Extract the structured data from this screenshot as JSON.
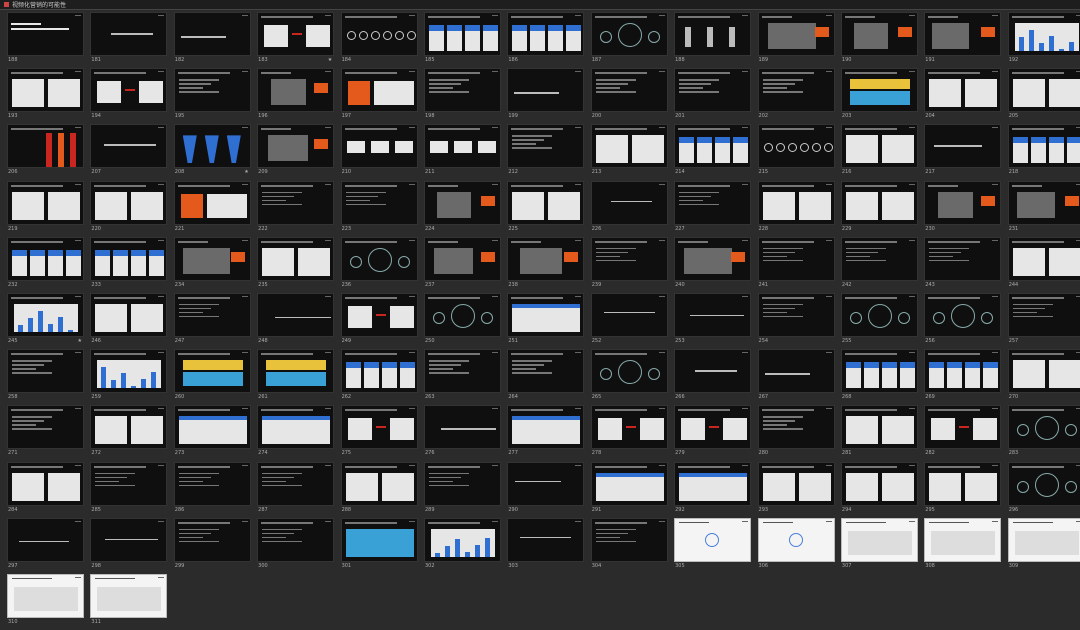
{
  "window": {
    "title": "视频化营销的可能性"
  },
  "slides": [
    {
      "num": "188",
      "style": "section",
      "star": false
    },
    {
      "num": "181",
      "style": "title",
      "star": false
    },
    {
      "num": "182",
      "style": "title",
      "star": false
    },
    {
      "num": "183",
      "style": "diagram",
      "star": true
    },
    {
      "num": "184",
      "style": "icons",
      "star": false
    },
    {
      "num": "185",
      "style": "cards",
      "star": false
    },
    {
      "num": "186",
      "style": "cards",
      "star": false
    },
    {
      "num": "187",
      "style": "circles",
      "star": false
    },
    {
      "num": "188",
      "style": "figures",
      "star": false
    },
    {
      "num": "189",
      "style": "photo",
      "star": false
    },
    {
      "num": "190",
      "style": "photo",
      "star": false
    },
    {
      "num": "191",
      "style": "photo",
      "star": false
    },
    {
      "num": "192",
      "style": "chart",
      "star": false
    },
    {
      "num": "193",
      "style": "panels",
      "star": false
    },
    {
      "num": "194",
      "style": "diagram",
      "star": false
    },
    {
      "num": "195",
      "style": "text",
      "star": false
    },
    {
      "num": "196",
      "style": "photo",
      "star": false
    },
    {
      "num": "197",
      "style": "orange",
      "star": false
    },
    {
      "num": "198",
      "style": "text",
      "star": false
    },
    {
      "num": "199",
      "style": "title",
      "star": false
    },
    {
      "num": "200",
      "style": "text",
      "star": false
    },
    {
      "num": "201",
      "style": "text",
      "star": false
    },
    {
      "num": "202",
      "style": "text",
      "star": false
    },
    {
      "num": "203",
      "style": "yellow",
      "star": false
    },
    {
      "num": "204",
      "style": "panels",
      "star": false
    },
    {
      "num": "205",
      "style": "panels",
      "star": false
    },
    {
      "num": "206",
      "style": "stripes",
      "star": false
    },
    {
      "num": "207",
      "style": "title",
      "star": false
    },
    {
      "num": "208",
      "style": "funnels",
      "star": true
    },
    {
      "num": "209",
      "style": "photo",
      "star": false
    },
    {
      "num": "210",
      "style": "flow",
      "star": false
    },
    {
      "num": "211",
      "style": "flow",
      "star": false
    },
    {
      "num": "212",
      "style": "text",
      "star": false
    },
    {
      "num": "213",
      "style": "panels",
      "star": false
    },
    {
      "num": "214",
      "style": "cards",
      "star": false
    },
    {
      "num": "215",
      "style": "icons",
      "star": false
    },
    {
      "num": "216",
      "style": "panels",
      "star": false
    },
    {
      "num": "217",
      "style": "title",
      "star": false
    },
    {
      "num": "218",
      "style": "cards",
      "star": false
    },
    {
      "num": "219",
      "style": "panels",
      "star": false
    },
    {
      "num": "220",
      "style": "panels",
      "star": false
    },
    {
      "num": "221",
      "style": "orange",
      "star": false
    },
    {
      "num": "222",
      "style": "text",
      "star": false
    },
    {
      "num": "223",
      "style": "text",
      "star": false
    },
    {
      "num": "224",
      "style": "photo",
      "star": false
    },
    {
      "num": "225",
      "style": "panels",
      "star": false
    },
    {
      "num": "226",
      "style": "title",
      "star": false
    },
    {
      "num": "227",
      "style": "text",
      "star": false
    },
    {
      "num": "228",
      "style": "panels",
      "star": false
    },
    {
      "num": "229",
      "style": "panels",
      "star": false
    },
    {
      "num": "230",
      "style": "photo",
      "star": false
    },
    {
      "num": "231",
      "style": "photo",
      "star": false
    },
    {
      "num": "232",
      "style": "cards",
      "star": false
    },
    {
      "num": "233",
      "style": "cards",
      "star": false
    },
    {
      "num": "234",
      "style": "photo",
      "star": false
    },
    {
      "num": "235",
      "style": "panels",
      "star": false
    },
    {
      "num": "236",
      "style": "circles",
      "star": false
    },
    {
      "num": "237",
      "style": "photo",
      "star": false
    },
    {
      "num": "238",
      "style": "photo",
      "star": false
    },
    {
      "num": "239",
      "style": "text",
      "star": false
    },
    {
      "num": "240",
      "style": "photo",
      "star": false
    },
    {
      "num": "241",
      "style": "text",
      "star": false
    },
    {
      "num": "242",
      "style": "text",
      "star": false
    },
    {
      "num": "243",
      "style": "text",
      "star": false
    },
    {
      "num": "244",
      "style": "panels",
      "star": false
    },
    {
      "num": "245",
      "style": "chart",
      "star": true
    },
    {
      "num": "246",
      "style": "panels",
      "star": false
    },
    {
      "num": "247",
      "style": "text",
      "star": false
    },
    {
      "num": "248",
      "style": "title",
      "star": false
    },
    {
      "num": "249",
      "style": "diagram",
      "star": false
    },
    {
      "num": "250",
      "style": "circles",
      "star": false
    },
    {
      "num": "251",
      "style": "table",
      "star": false
    },
    {
      "num": "252",
      "style": "title",
      "star": false
    },
    {
      "num": "253",
      "style": "title",
      "star": false
    },
    {
      "num": "254",
      "style": "text",
      "star": false
    },
    {
      "num": "255",
      "style": "circles",
      "star": false
    },
    {
      "num": "256",
      "style": "circles",
      "star": false
    },
    {
      "num": "257",
      "style": "text",
      "star": false
    },
    {
      "num": "258",
      "style": "text",
      "star": false
    },
    {
      "num": "259",
      "style": "chart",
      "star": false
    },
    {
      "num": "260",
      "style": "yellow",
      "star": false
    },
    {
      "num": "261",
      "style": "yellow",
      "star": false
    },
    {
      "num": "262",
      "style": "cards",
      "star": false
    },
    {
      "num": "263",
      "style": "text",
      "star": false
    },
    {
      "num": "264",
      "style": "text",
      "star": false
    },
    {
      "num": "265",
      "style": "circles",
      "star": false
    },
    {
      "num": "266",
      "style": "title",
      "star": false
    },
    {
      "num": "267",
      "style": "title",
      "star": false
    },
    {
      "num": "268",
      "style": "cards",
      "star": false
    },
    {
      "num": "269",
      "style": "cards",
      "star": false
    },
    {
      "num": "270",
      "style": "panels",
      "star": false
    },
    {
      "num": "271",
      "style": "text",
      "star": false
    },
    {
      "num": "272",
      "style": "panels",
      "star": false
    },
    {
      "num": "273",
      "style": "table",
      "star": false
    },
    {
      "num": "274",
      "style": "table",
      "star": false
    },
    {
      "num": "275",
      "style": "diagram",
      "star": false
    },
    {
      "num": "276",
      "style": "title",
      "star": false
    },
    {
      "num": "277",
      "style": "table",
      "star": false
    },
    {
      "num": "278",
      "style": "diagram",
      "star": false
    },
    {
      "num": "279",
      "style": "diagram",
      "star": false
    },
    {
      "num": "280",
      "style": "text",
      "star": false
    },
    {
      "num": "281",
      "style": "panels",
      "star": false
    },
    {
      "num": "282",
      "style": "diagram",
      "star": false
    },
    {
      "num": "283",
      "style": "circles",
      "star": false
    },
    {
      "num": "284",
      "style": "panels",
      "star": false
    },
    {
      "num": "285",
      "style": "text",
      "star": false
    },
    {
      "num": "286",
      "style": "text",
      "star": false
    },
    {
      "num": "287",
      "style": "text",
      "star": false
    },
    {
      "num": "288",
      "style": "panels",
      "star": false
    },
    {
      "num": "289",
      "style": "text",
      "star": false
    },
    {
      "num": "290",
      "style": "title",
      "star": false
    },
    {
      "num": "291",
      "style": "table",
      "star": false
    },
    {
      "num": "292",
      "style": "table",
      "star": false
    },
    {
      "num": "293",
      "style": "panels",
      "star": false
    },
    {
      "num": "294",
      "style": "panels",
      "star": false
    },
    {
      "num": "295",
      "style": "panels",
      "star": false
    },
    {
      "num": "296",
      "style": "circles",
      "star": false
    },
    {
      "num": "297",
      "style": "title",
      "star": false
    },
    {
      "num": "298",
      "style": "title",
      "star": false
    },
    {
      "num": "299",
      "style": "text",
      "star": false
    },
    {
      "num": "300",
      "style": "text",
      "star": false
    },
    {
      "num": "301",
      "style": "bluegrid",
      "star": false
    },
    {
      "num": "302",
      "style": "chart",
      "star": false
    },
    {
      "num": "303",
      "style": "title",
      "star": false
    },
    {
      "num": "304",
      "style": "text",
      "star": false
    },
    {
      "num": "305",
      "style": "lightdiag",
      "star": false
    },
    {
      "num": "306",
      "style": "lightdiag",
      "star": false
    },
    {
      "num": "307",
      "style": "light",
      "star": false
    },
    {
      "num": "308",
      "style": "light",
      "star": false
    },
    {
      "num": "309",
      "style": "light",
      "star": false
    },
    {
      "num": "310",
      "style": "light",
      "star": false
    },
    {
      "num": "311",
      "style": "light",
      "star": false
    }
  ]
}
